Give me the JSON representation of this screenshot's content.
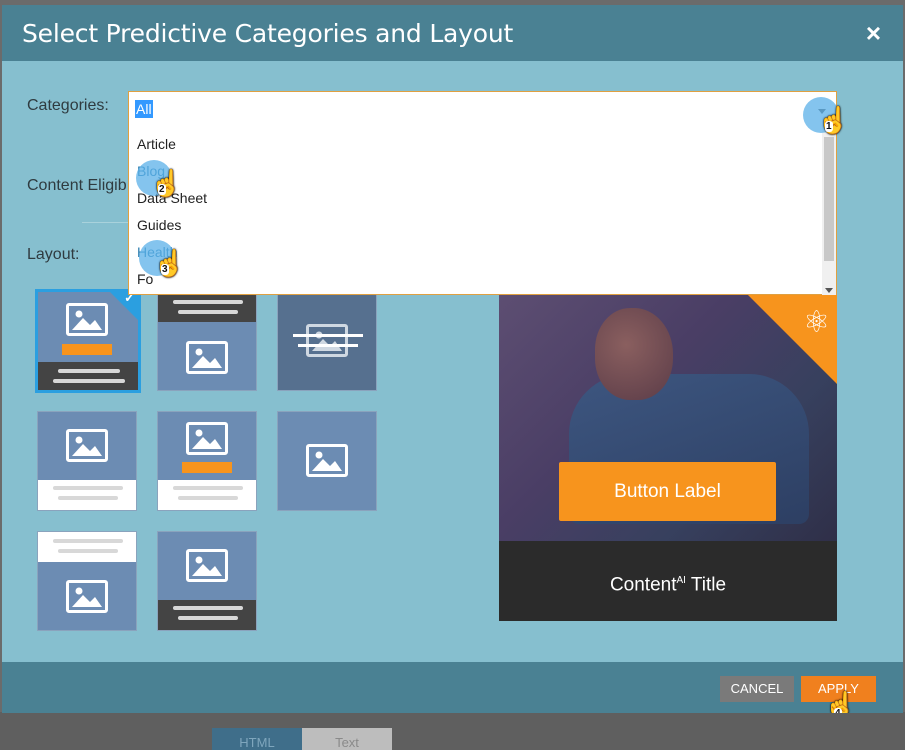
{
  "dialog": {
    "title": "Select Predictive Categories and Layout",
    "close_icon": "×"
  },
  "form": {
    "categories_label": "Categories:",
    "content_eligibility_label": "Content Eligib",
    "layout_label": "Layout:"
  },
  "categories_select": {
    "selected": "All",
    "options": [
      {
        "label": "Article"
      },
      {
        "label": "Blog"
      },
      {
        "label": "Data Sheet"
      },
      {
        "label": "Guides"
      },
      {
        "label": "Health"
      },
      {
        "label": "Fo"
      }
    ]
  },
  "preview": {
    "button_label": "Button Label",
    "title_main": "Content",
    "title_sup": "AI",
    "title_end": " Title",
    "brand_icon": "atom-icon"
  },
  "footer": {
    "cancel_label": "CANCEL",
    "apply_label": "APPLY"
  },
  "annotations": {
    "step1": "1",
    "step2": "2",
    "step3": "3",
    "step4": "4"
  },
  "background": {
    "tab_html": "HTML",
    "tab_text": "Text"
  },
  "colors": {
    "header": "#4a8193",
    "body": "#86bfcf",
    "accent_orange": "#f7941d",
    "selected_border": "#2b9fe0"
  }
}
